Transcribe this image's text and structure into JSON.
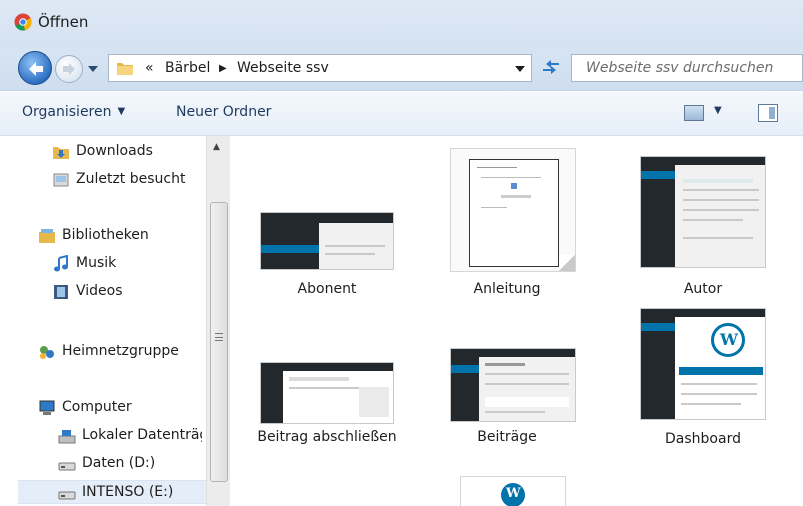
{
  "window": {
    "title": "Öffnen",
    "icon": "chrome-icon"
  },
  "address": {
    "overflow": "«",
    "crumbs": [
      "Bärbel",
      "Webseite ssv"
    ],
    "search_placeholder": "Webseite ssv durchsuchen"
  },
  "toolbar": {
    "organize": "Organisieren",
    "new_folder": "Neuer Ordner"
  },
  "nav": {
    "items": [
      {
        "label": "Downloads",
        "icon": "downloads-folder-icon"
      },
      {
        "label": "Zuletzt besucht",
        "icon": "recent-places-icon"
      },
      {
        "label": "Bibliotheken",
        "icon": "libraries-icon"
      },
      {
        "label": "Musik",
        "icon": "music-icon"
      },
      {
        "label": "Videos",
        "icon": "videos-icon"
      },
      {
        "label": "Heimnetzgruppe",
        "icon": "homegroup-icon"
      },
      {
        "label": "Computer",
        "icon": "computer-icon"
      },
      {
        "label": "Lokaler Datenträg",
        "icon": "local-disk-icon"
      },
      {
        "label": "Daten (D:)",
        "icon": "drive-icon"
      },
      {
        "label": "INTENSO (E:)",
        "icon": "drive-icon"
      }
    ]
  },
  "files": [
    {
      "name": "Abonent"
    },
    {
      "name": "Anleitung"
    },
    {
      "name": "Autor"
    },
    {
      "name": "Beitrag abschließen"
    },
    {
      "name": "Beiträge"
    },
    {
      "name": "Dashboard"
    }
  ],
  "colors": {
    "wp_dark": "#23282d",
    "wp_blue": "#0073aa",
    "title_bg": "#dfe9f5"
  }
}
